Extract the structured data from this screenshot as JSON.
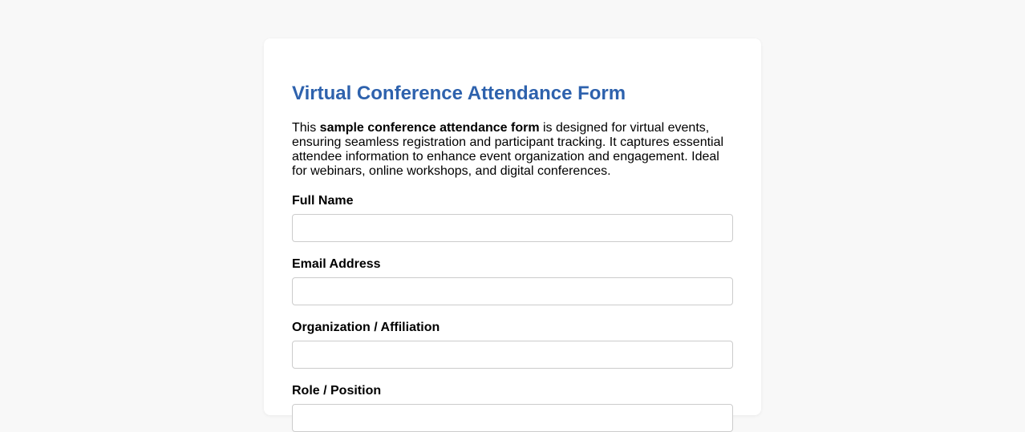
{
  "form": {
    "title": "Virtual Conference Attendance Form",
    "intro": {
      "prefix": "This ",
      "bold": "sample conference attendance form",
      "suffix": " is designed for virtual events, ensuring seamless registration and participant tracking. It captures essential attendee information to enhance event organization and engagement. Ideal for webinars, online workshops, and digital conferences."
    },
    "fields": [
      {
        "label": "Full Name",
        "value": "",
        "placeholder": ""
      },
      {
        "label": "Email Address",
        "value": "",
        "placeholder": ""
      },
      {
        "label": "Organization / Affiliation",
        "value": "",
        "placeholder": ""
      },
      {
        "label": "Role / Position",
        "value": "",
        "placeholder": ""
      }
    ]
  },
  "colors": {
    "page_background": "#f8f8f8",
    "card_background": "#ffffff",
    "title": "#2e62ad",
    "input_border": "#cccccc"
  }
}
